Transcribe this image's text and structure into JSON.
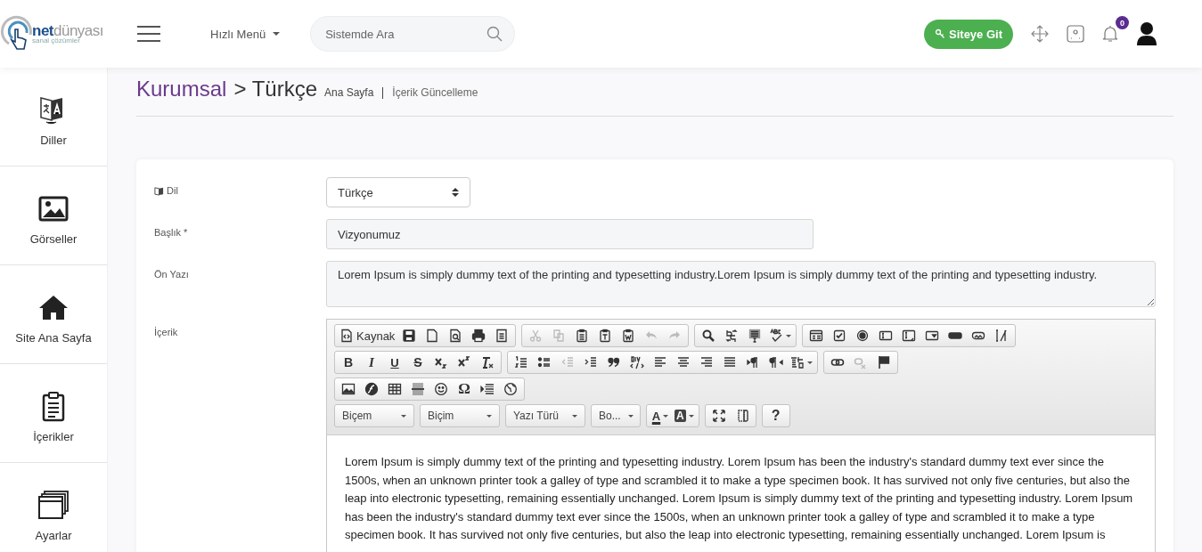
{
  "header": {
    "logo": {
      "bold": "net",
      "light": "dünyası",
      "tagline": "sanal çözümler"
    },
    "quick_menu": "Hızlı Menü",
    "search": {
      "placeholder": "Sistemde Ara"
    },
    "site_button": "Siteye Git",
    "notification_count": "0"
  },
  "sidebar": {
    "items": [
      {
        "label": "Diller",
        "kind": "language"
      },
      {
        "label": "Görseller",
        "kind": "image"
      },
      {
        "label": "Site Ana Sayfa",
        "kind": "home"
      },
      {
        "label": "İçerikler",
        "kind": "clipboard"
      },
      {
        "label": "Ayarlar",
        "kind": "windows"
      }
    ]
  },
  "page": {
    "title": "Kurumsal",
    "subtitle": "> Türkçe",
    "breadcrumb": [
      "Ana Sayfa",
      "İçerik Güncelleme"
    ]
  },
  "form": {
    "language": {
      "label": "Dil",
      "value": "Türkçe"
    },
    "title": {
      "label": "Başlık *",
      "value": "Vizyonumuz"
    },
    "summary": {
      "label": "Ön Yazı",
      "value": "Lorem Ipsum is simply dummy text of the printing and typesetting industry.Lorem Ipsum is simply dummy text of the printing and typesetting industry."
    },
    "content": {
      "label": "İçerik",
      "toolbar": [
        [
          [
            {
              "kind": "source",
              "label": "Kaynak",
              "disabled": false
            },
            {
              "kind": "save",
              "disabled": false
            },
            {
              "kind": "newpage",
              "disabled": false
            },
            {
              "kind": "preview",
              "disabled": false
            },
            {
              "kind": "print",
              "disabled": false
            },
            {
              "kind": "templates",
              "disabled": false
            }
          ],
          [
            {
              "kind": "cut",
              "disabled": true
            },
            {
              "kind": "copy",
              "disabled": true
            },
            {
              "kind": "paste",
              "disabled": false
            },
            {
              "kind": "pastetext",
              "disabled": false
            },
            {
              "kind": "pasteword",
              "disabled": false
            },
            {
              "kind": "undo",
              "disabled": true
            },
            {
              "kind": "redo",
              "disabled": true
            }
          ],
          [
            {
              "kind": "find",
              "disabled": false
            },
            {
              "kind": "replace",
              "disabled": false
            },
            {
              "kind": "selectall",
              "disabled": false
            },
            {
              "kind": "spell",
              "disabled": false
            }
          ],
          [
            {
              "kind": "form",
              "disabled": false
            },
            {
              "kind": "checkbox",
              "disabled": false
            },
            {
              "kind": "radio",
              "disabled": false
            },
            {
              "kind": "textfield",
              "disabled": false
            },
            {
              "kind": "textarea",
              "disabled": false
            },
            {
              "kind": "select",
              "disabled": false
            },
            {
              "kind": "button",
              "disabled": false
            },
            {
              "kind": "imagebutton",
              "disabled": false
            },
            {
              "kind": "hidden",
              "disabled": false
            }
          ]
        ],
        [
          [
            {
              "kind": "bold",
              "label": "B",
              "disabled": false
            },
            {
              "kind": "italic",
              "label": "I",
              "disabled": false
            },
            {
              "kind": "underline",
              "label": "U",
              "disabled": false
            },
            {
              "kind": "strike",
              "label": "S",
              "disabled": false
            },
            {
              "kind": "subscript",
              "disabled": false
            },
            {
              "kind": "superscript",
              "disabled": false
            },
            {
              "kind": "removeformat",
              "disabled": false
            }
          ],
          [
            {
              "kind": "numberedlist",
              "disabled": false
            },
            {
              "kind": "bulletlist",
              "disabled": false
            },
            {
              "kind": "outdent",
              "disabled": true
            },
            {
              "kind": "indent",
              "disabled": false
            },
            {
              "kind": "blockquote",
              "disabled": false
            },
            {
              "kind": "div",
              "disabled": false
            },
            {
              "kind": "alignleft",
              "disabled": false
            },
            {
              "kind": "aligncenter",
              "disabled": false
            },
            {
              "kind": "alignright",
              "disabled": false
            },
            {
              "kind": "justify",
              "disabled": false
            },
            {
              "kind": "ltr",
              "disabled": false
            },
            {
              "kind": "rtl",
              "disabled": false
            },
            {
              "kind": "languagemenu",
              "disabled": false
            }
          ],
          [
            {
              "kind": "link",
              "disabled": false
            },
            {
              "kind": "unlink",
              "disabled": true
            },
            {
              "kind": "anchor",
              "disabled": false
            }
          ]
        ],
        [
          [
            {
              "kind": "image",
              "disabled": false
            },
            {
              "kind": "flash",
              "disabled": false
            },
            {
              "kind": "table",
              "disabled": false
            },
            {
              "kind": "hr",
              "disabled": false
            },
            {
              "kind": "smiley",
              "disabled": false
            },
            {
              "kind": "specialchar",
              "label": "Ω",
              "disabled": false
            },
            {
              "kind": "pagebreak",
              "disabled": false
            },
            {
              "kind": "iframe",
              "disabled": false
            }
          ]
        ]
      ],
      "combos": [
        "Biçem",
        "Biçim",
        "Yazı Türü",
        "Bo..."
      ],
      "color_buttons": [
        {
          "kind": "textcolor",
          "label": "A"
        },
        {
          "kind": "bgcolor",
          "label": "A"
        }
      ],
      "view_buttons": [
        {
          "kind": "maximize"
        },
        {
          "kind": "showblocks"
        }
      ],
      "help": "?",
      "body": "Lorem Ipsum is simply dummy text of the printing and typesetting industry. Lorem Ipsum has been the industry's standard dummy text ever since the 1500s, when an unknown printer took a galley of type and scrambled it to make a type specimen book. It has survived not only five centuries, but also the leap into electronic typesetting, remaining essentially unchanged. Lorem Ipsum is simply dummy text of the printing and typesetting industry. Lorem Ipsum has been the industry's standard dummy text ever since the 1500s, when an unknown printer took a galley of type and scrambled it to make a type specimen book. It has survived not only five centuries, but also the leap into electronic typesetting, remaining essentially unchanged. Lorem Ipsum is"
    }
  }
}
